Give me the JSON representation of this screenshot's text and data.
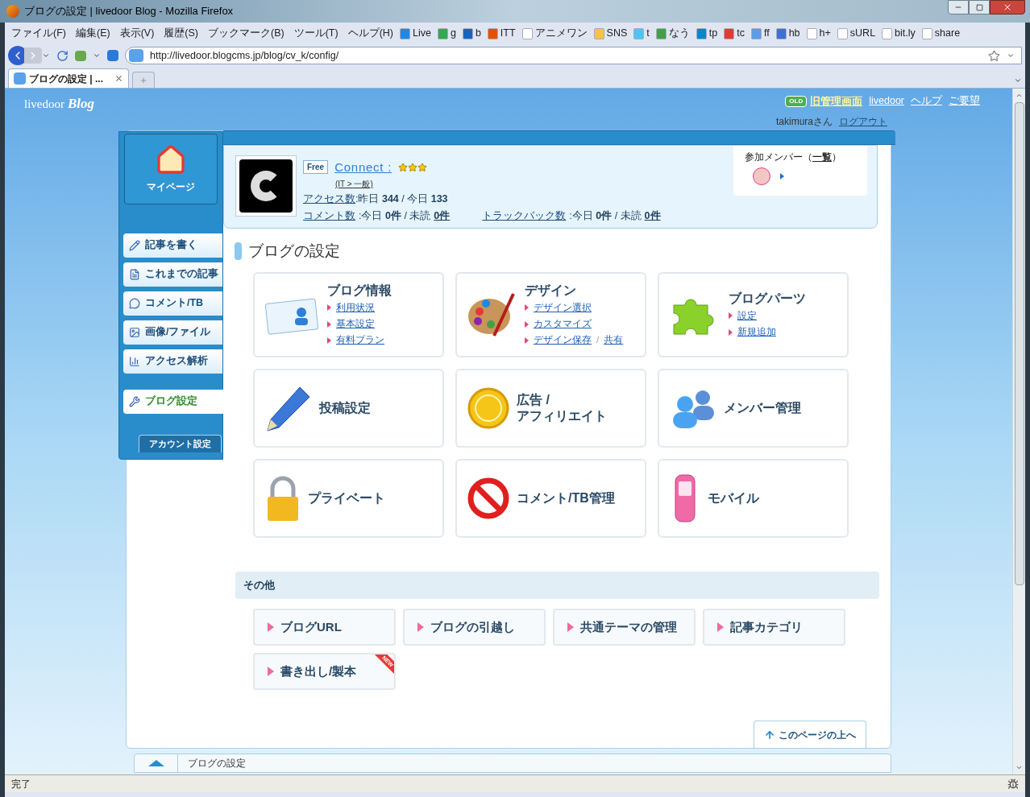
{
  "window": {
    "title": "ブログの設定 | livedoor Blog - Mozilla Firefox"
  },
  "menu": [
    "ファイル(F)",
    "編集(E)",
    "表示(V)",
    "履歴(S)",
    "ブックマーク(B)",
    "ツール(T)",
    "ヘルプ(H)"
  ],
  "bookmarks": [
    "Live",
    "g",
    "b",
    "ITT",
    "アニメワン",
    "SNS",
    "t",
    "なう",
    "tp",
    "tc",
    "ff",
    "hb",
    "h+",
    "sURL",
    "bit.ly",
    "share"
  ],
  "address": {
    "url": "http://livedoor.blogcms.jp/blog/cv_k/config/"
  },
  "tabs": [
    {
      "label": "ブログの設定 | ...",
      "selected": true
    }
  ],
  "header": {
    "logo": {
      "brand": "livedoor",
      "product": "Blog"
    },
    "old_badge": "OLD",
    "links": [
      "旧管理画面",
      "livedoor",
      "ヘルプ",
      "ご要望"
    ],
    "user": "takimuraさん",
    "logout": "ログアウト"
  },
  "sidebar": {
    "mypage": "マイページ",
    "items": [
      {
        "label": "記事を書く",
        "selected": false
      },
      {
        "label": "これまでの記事",
        "selected": false
      },
      {
        "label": "コメント/TB",
        "selected": false
      },
      {
        "label": "画像/ファイル",
        "selected": false
      },
      {
        "label": "アクセス解析",
        "selected": false
      },
      {
        "label": "ブログ設定",
        "selected": true
      }
    ],
    "account": "アカウント設定"
  },
  "profile": {
    "plan": "Free",
    "name": "Connect :",
    "stars": 3,
    "category": "(IT > 一般)",
    "access": {
      "label": "アクセス数",
      "text": ":昨日 **344** / 今日 **133**"
    },
    "comments": {
      "label": "コメント数",
      "text": ":今日 **0件** / 未読",
      "unread": "0件"
    },
    "trackbacks": {
      "label": "トラックバック数",
      "text": ":今日 **0件** / 未読",
      "unread": "0件"
    },
    "members": {
      "title": "参加メンバー（",
      "link": "一覧",
      "suffix": "）"
    }
  },
  "page_title": "ブログの設定",
  "cards": [
    {
      "title": "ブログ情報",
      "kind": "card-info",
      "links": [
        {
          "items": [
            "利用状況"
          ]
        },
        {
          "items": [
            "基本設定"
          ]
        },
        {
          "items": [
            "有料プラン"
          ]
        }
      ]
    },
    {
      "title": "デザイン",
      "kind": "palette",
      "links": [
        {
          "items": [
            "デザイン選択"
          ]
        },
        {
          "items": [
            "カスタマイズ"
          ]
        },
        {
          "items": [
            "デザイン保存",
            "共有"
          ],
          "separator": "/"
        }
      ]
    },
    {
      "title": "ブログパーツ",
      "kind": "puzzle",
      "links": [
        {
          "items": [
            "設定"
          ]
        },
        {
          "items": [
            "新規追加"
          ]
        }
      ]
    },
    {
      "title": "投稿設定",
      "kind": "pencil"
    },
    {
      "title": "広告 /\nアフィリエイト",
      "kind": "coin"
    },
    {
      "title": "メンバー管理",
      "kind": "people"
    },
    {
      "title": "プライベート",
      "kind": "lock"
    },
    {
      "title": "コメント/TB管理",
      "kind": "forbidden"
    },
    {
      "title": "モバイル",
      "kind": "phone"
    }
  ],
  "other": {
    "title": "その他",
    "items": [
      {
        "label": "ブログURL"
      },
      {
        "label": "ブログの引越し"
      },
      {
        "label": "共通テーマの管理"
      },
      {
        "label": "記事カテゴリ"
      },
      {
        "label": "書き出し/製本",
        "badge": "NEW"
      }
    ]
  },
  "back_to_top": "このページの上へ",
  "breadcrumb": "ブログの設定",
  "status": "完了"
}
